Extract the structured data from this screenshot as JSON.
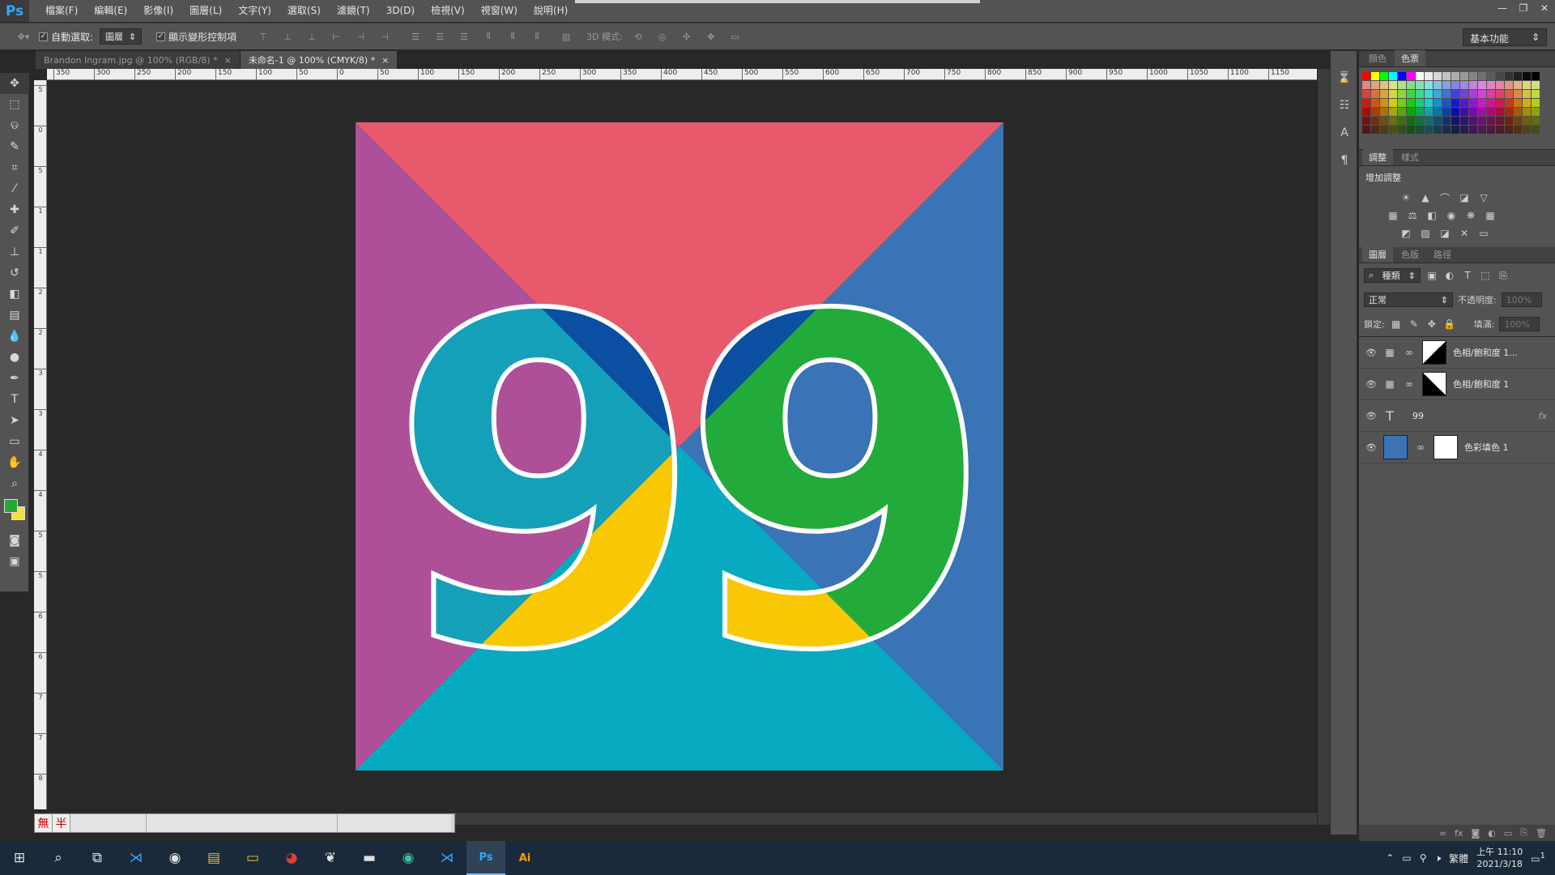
{
  "app": {
    "logo": "Ps",
    "menus": [
      "檔案(F)",
      "編輯(E)",
      "影像(I)",
      "圖層(L)",
      "文字(Y)",
      "選取(S)",
      "濾鏡(T)",
      "3D(D)",
      "檢視(V)",
      "視窗(W)",
      "說明(H)"
    ],
    "window_controls": [
      "—",
      "❐",
      "✕"
    ]
  },
  "options": {
    "auto_select_label": "自動選取:",
    "auto_select_value": "圖層",
    "show_transform_label": "顯示變形控制項",
    "mode_3d_label": "3D 模式:",
    "workspace": "基本功能"
  },
  "tabs": [
    {
      "label": "Brandon Ingram.jpg @ 100% (RGB/8) *",
      "close": "×"
    },
    {
      "label": "未命名-1 @ 100% (CMYK/8) *",
      "close": "×"
    }
  ],
  "ruler_h": [
    "350",
    "300",
    "250",
    "200",
    "150",
    "100",
    "50",
    "0",
    "50",
    "100",
    "150",
    "200",
    "250",
    "300",
    "350",
    "400",
    "450",
    "500",
    "550",
    "600",
    "650",
    "700",
    "750",
    "800",
    "850",
    "900",
    "950",
    "1000",
    "1050",
    "1100",
    "1150"
  ],
  "ruler_v": [
    "5",
    "0",
    "5",
    "1",
    "1",
    "2",
    "2",
    "3",
    "3",
    "4",
    "4",
    "5",
    "5",
    "6",
    "6",
    "7",
    "7",
    "8"
  ],
  "artwork": {
    "text": "99",
    "colors": {
      "top": "#e65a6b",
      "left": "#ae5098",
      "right": "#3a73b6",
      "bottom": "#08aac2",
      "navy": "#0a4fa2",
      "teal": "#14a0b8",
      "green": "#22ab3a",
      "yellow": "#f8c805",
      "outline": "#ffffff"
    }
  },
  "ime": {
    "cell1": "無",
    "cell2": "半"
  },
  "swatches_tabs": [
    "顏色",
    "色票"
  ],
  "adjust_tabs": [
    "調整",
    "樣式"
  ],
  "adjust_title": "增加調整",
  "layers_tabs": [
    "圖層",
    "色版",
    "路徑"
  ],
  "layers_filter": "種類",
  "blend_mode": "正常",
  "opacity_label": "不透明度:",
  "opacity_value": "100%",
  "lock_label": "鎖定:",
  "fill_label": "填滿:",
  "fill_value": "100%",
  "layers": [
    {
      "name": "色相/飽和度 1...",
      "type": "adjust"
    },
    {
      "name": "色相/飽和度 1",
      "type": "adjust"
    },
    {
      "name": "99",
      "type": "text",
      "fx": "fx"
    },
    {
      "name": "色彩填色 1",
      "type": "fill"
    }
  ],
  "taskbar": {
    "clock_time": "上午 11:10",
    "clock_date": "2021/3/18",
    "lang": "繁體",
    "notif": "1"
  }
}
